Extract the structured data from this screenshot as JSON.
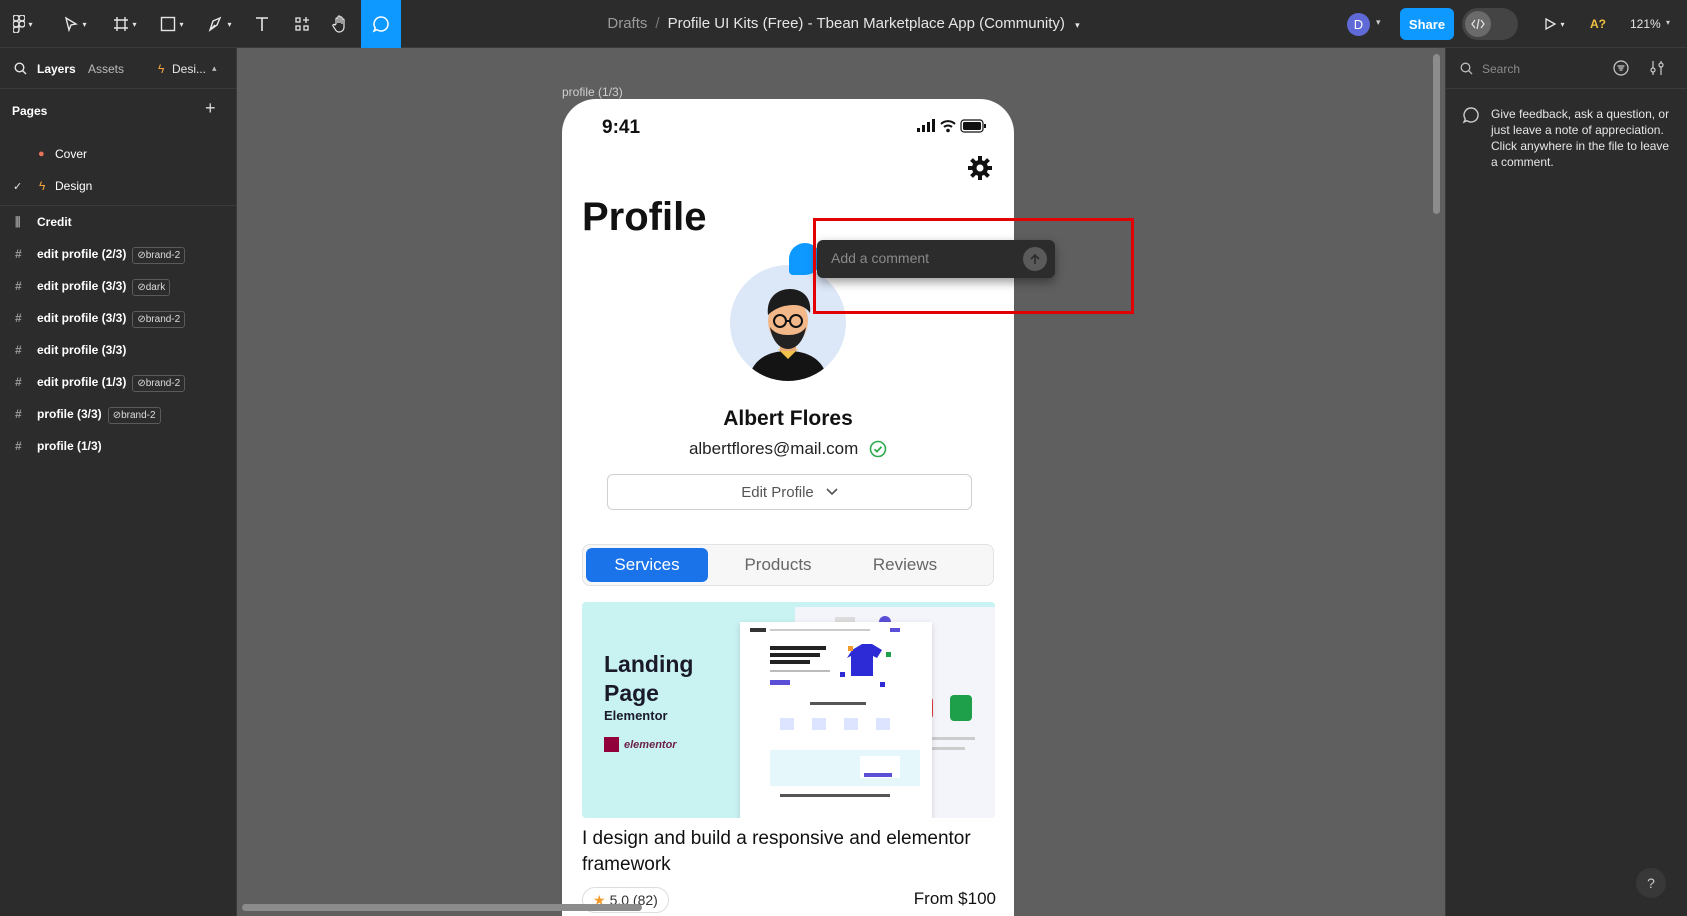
{
  "toolbar": {
    "breadcrumb_root": "Drafts",
    "separator": "/",
    "file_title": "Profile UI Kits (Free) - Tbean Marketplace App (Community)",
    "user_initial": "D",
    "share_label": "Share",
    "ai_badge": "A?",
    "zoom_level": "121%",
    "accent_color": "#0d99ff"
  },
  "left_panel": {
    "tab_layers": "Layers",
    "tab_assets": "Assets",
    "tab_design": "Desi...",
    "pages_heading": "Pages",
    "pages": [
      {
        "label": "Cover",
        "selected": false
      },
      {
        "label": "Design",
        "selected": true
      }
    ],
    "layers": [
      {
        "label": "Credit",
        "badge": ""
      },
      {
        "label": "edit profile (2/3)",
        "badge": "brand-2"
      },
      {
        "label": "edit profile (3/3)",
        "badge": "dark"
      },
      {
        "label": "edit profile (3/3)",
        "badge": "brand-2"
      },
      {
        "label": "edit profile (3/3)",
        "badge": ""
      },
      {
        "label": "edit profile (1/3)",
        "badge": "brand-2"
      },
      {
        "label": "profile (3/3)",
        "badge": "brand-2"
      },
      {
        "label": "profile (1/3)",
        "badge": ""
      }
    ]
  },
  "canvas": {
    "frame_label": "profile (1/3)",
    "phone": {
      "status_time": "9:41",
      "title": "Profile",
      "name": "Albert Flores",
      "email": "albertflores@mail.com",
      "edit_button": "Edit Profile",
      "tabs": [
        "Services",
        "Products",
        "Reviews"
      ],
      "active_tab": "Services",
      "service_image": {
        "title_line1": "Landing",
        "title_line2": "Page",
        "subtitle": "Elementor",
        "logo_text": "elementor"
      },
      "service_description": "I design and build a responsive and elementor framework",
      "rating": "5.0 (82)",
      "price": "From $100"
    },
    "comment": {
      "placeholder": "Add a comment",
      "highlight_color": "#e20000"
    }
  },
  "right_panel": {
    "search_placeholder": "Search",
    "note": "Give feedback, ask a question, or just leave a note of appreciation. Click anywhere in the file to leave a comment.",
    "help_label": "?"
  }
}
